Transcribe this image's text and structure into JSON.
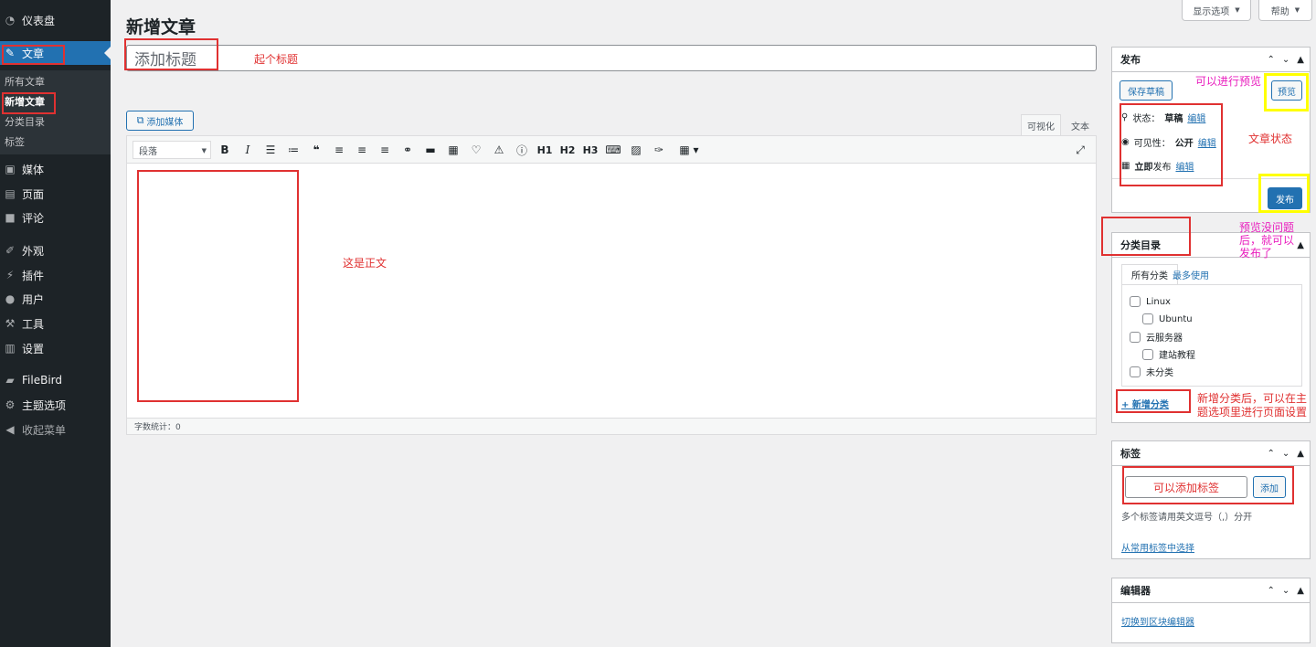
{
  "sidebar": {
    "items": [
      {
        "label": "仪表盘",
        "icon": "dashboard-icon"
      },
      {
        "label": "文章",
        "icon": "pin-icon"
      },
      {
        "label": "媒体",
        "icon": "media-icon"
      },
      {
        "label": "页面",
        "icon": "page-icon"
      },
      {
        "label": "评论",
        "icon": "comment-icon"
      },
      {
        "label": "外观",
        "icon": "brush-icon"
      },
      {
        "label": "插件",
        "icon": "plugin-icon"
      },
      {
        "label": "用户",
        "icon": "user-icon"
      },
      {
        "label": "工具",
        "icon": "wrench-icon"
      },
      {
        "label": "设置",
        "icon": "settings-icon"
      },
      {
        "label": "FileBird",
        "icon": "folder-icon"
      },
      {
        "label": "主题选项",
        "icon": "gear-icon"
      },
      {
        "label": "收起菜单",
        "icon": "collapse-icon"
      }
    ],
    "submenu": [
      "所有文章",
      "新增文章",
      "分类目录",
      "标签"
    ]
  },
  "header": {
    "screen_options": "显示选项",
    "help": "帮助",
    "title": "新增文章"
  },
  "title_field": {
    "placeholder": "添加标题"
  },
  "editor": {
    "add_media": "添加媒体",
    "tab_visual": "可视化",
    "tab_text": "文本",
    "format": "段落",
    "word_count": "字数统计：0"
  },
  "publish": {
    "title": "发布",
    "save_draft": "保存草稿",
    "preview": "预览",
    "status_label": "状态：",
    "status_value": "草稿",
    "visibility_label": "可见性：",
    "visibility_value": "公开",
    "publish_immediately": "立即",
    "publish_suffix": "发布",
    "edit": "编辑",
    "publish_button": "发布"
  },
  "categories": {
    "title": "分类目录",
    "tab_all": "所有分类",
    "tab_popular": "最多使用",
    "items": [
      "Linux",
      "Ubuntu",
      "云服务器",
      "建站教程",
      "未分类"
    ],
    "add_new": "+ 新增分类"
  },
  "tags": {
    "title": "标签",
    "input_placeholder": "可以添加标签",
    "add": "添加",
    "hint": "多个标签请用英文逗号（,）分开",
    "choose": "从常用标签中选择"
  },
  "editor_box": {
    "title": "编辑器",
    "switch": "切换到区块编辑器"
  },
  "annotations": {
    "title_note": "起个标题",
    "body_note": "这是正文",
    "preview_note": "可以进行预览",
    "status_note": "文章状态",
    "publish_note": "预览没问题后，就可以发布了",
    "category_note": "新增分类后，可以在主题选项里进行页面设置"
  },
  "colors": {
    "sidebar_bg": "#1d2327",
    "accent": "#2271b1",
    "annotation_red": "#e03131",
    "annotation_pink": "#e91ebe",
    "annotation_yellow": "#ffff00"
  }
}
